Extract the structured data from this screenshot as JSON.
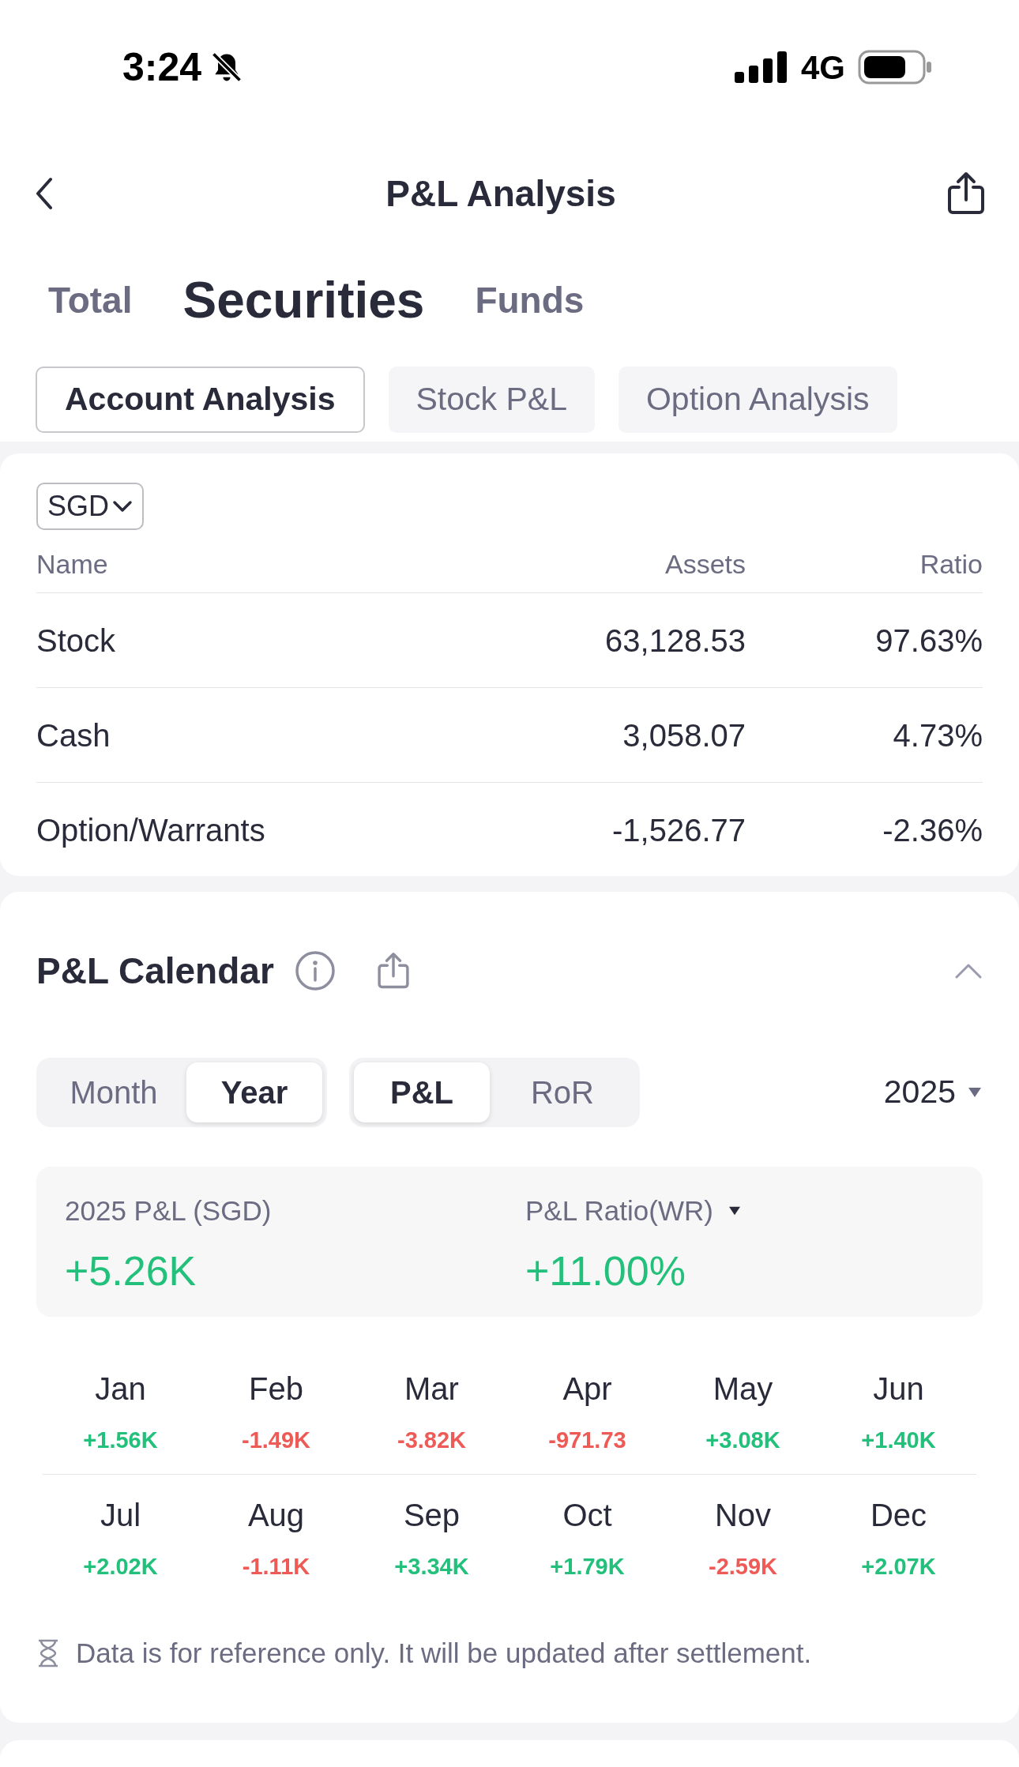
{
  "status_bar": {
    "time": "3:24",
    "silent": true,
    "network": "4G"
  },
  "nav": {
    "title": "P&L Analysis"
  },
  "top_tabs": [
    {
      "label": "Total",
      "selected": false
    },
    {
      "label": "Securities",
      "selected": true
    },
    {
      "label": "Funds",
      "selected": false
    }
  ],
  "sub_tabs": [
    {
      "label": "Account Analysis",
      "selected": true
    },
    {
      "label": "Stock P&L",
      "selected": false
    },
    {
      "label": "Option Analysis",
      "selected": false
    }
  ],
  "assets": {
    "currency": "SGD",
    "columns": [
      "Name",
      "Assets",
      "Ratio"
    ],
    "rows": [
      {
        "name": "Stock",
        "assets": "63,128.53",
        "ratio": "97.63%"
      },
      {
        "name": "Cash",
        "assets": "3,058.07",
        "ratio": "4.73%"
      },
      {
        "name": "Option/Warrants",
        "assets": "-1,526.77",
        "ratio": "-2.36%"
      }
    ]
  },
  "calendar": {
    "title": "P&L Calendar",
    "expanded": true,
    "period_toggle": [
      {
        "label": "Month",
        "selected": false
      },
      {
        "label": "Year",
        "selected": true
      }
    ],
    "metric_toggle": [
      {
        "label": "P&L",
        "selected": true
      },
      {
        "label": "RoR",
        "selected": false
      }
    ],
    "year": "2025",
    "summary": {
      "pnl_label": "2025 P&L (SGD)",
      "pnl_value": "+5.26K",
      "ratio_label": "P&L Ratio(WR)",
      "ratio_value": "+11.00%"
    },
    "months": [
      {
        "month": "Jan",
        "value": "+1.56K",
        "color": "#22c07a"
      },
      {
        "month": "Feb",
        "value": "-1.49K",
        "color": "#ee5a55"
      },
      {
        "month": "Mar",
        "value": "-3.82K",
        "color": "#ee5a55"
      },
      {
        "month": "Apr",
        "value": "-971.73",
        "color": "#ee5a55"
      },
      {
        "month": "May",
        "value": "+3.08K",
        "color": "#22c07a"
      },
      {
        "month": "Jun",
        "value": "+1.40K",
        "color": "#22c07a"
      },
      {
        "month": "Jul",
        "value": "+2.02K",
        "color": "#22c07a"
      },
      {
        "month": "Aug",
        "value": "-1.11K",
        "color": "#ee5a55"
      },
      {
        "month": "Sep",
        "value": "+3.34K",
        "color": "#22c07a"
      },
      {
        "month": "Oct",
        "value": "+1.79K",
        "color": "#22c07a"
      },
      {
        "month": "Nov",
        "value": "-2.59K",
        "color": "#ee5a55"
      },
      {
        "month": "Dec",
        "value": "+2.07K",
        "color": "#22c07a"
      }
    ],
    "note": "Data is for reference only. It will be updated after settlement."
  }
}
